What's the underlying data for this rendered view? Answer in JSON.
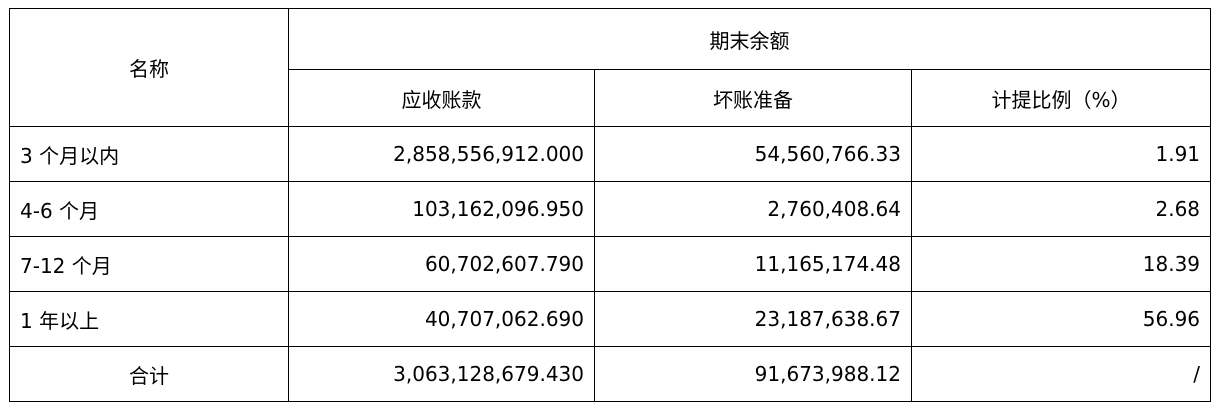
{
  "table": {
    "header": {
      "name_col": "名称",
      "group_title": "期末余额",
      "sub_headers": [
        "应收账款",
        "坏账准备",
        "计提比例（%）"
      ]
    },
    "rows": [
      {
        "name": "3 个月以内",
        "receivable": "2,858,556,912.000",
        "provision": "54,560,766.33",
        "ratio": "1.91"
      },
      {
        "name": "4-6 个月",
        "receivable": "103,162,096.950",
        "provision": "2,760,408.64",
        "ratio": "2.68"
      },
      {
        "name": "7-12 个月",
        "receivable": "60,702,607.790",
        "provision": "11,165,174.48",
        "ratio": "18.39"
      },
      {
        "name": "1 年以上",
        "receivable": "40,707,062.690",
        "provision": "23,187,638.67",
        "ratio": "56.96"
      }
    ],
    "total": {
      "name": "合计",
      "receivable": "3,063,128,679.430",
      "provision": "91,673,988.12",
      "ratio": "/"
    }
  }
}
